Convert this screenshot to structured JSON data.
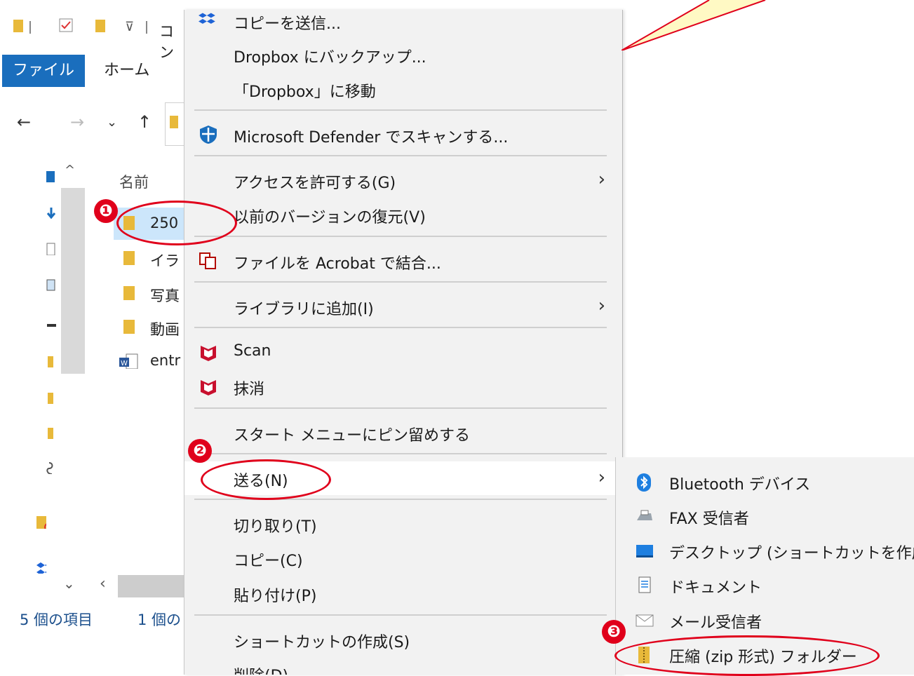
{
  "explorer": {
    "qat_title": "コン",
    "tab_file": "ファイル",
    "tab_home": "ホーム",
    "column_name": "名前",
    "files": [
      {
        "name": "250",
        "type": "folder",
        "selected": true
      },
      {
        "name": "イラ",
        "type": "folder"
      },
      {
        "name": "写真",
        "type": "folder"
      },
      {
        "name": "動画",
        "type": "folder"
      },
      {
        "name": "entr",
        "type": "word"
      }
    ],
    "status_count": "5 個の項目",
    "status_selected": "1 個の"
  },
  "context_menu": {
    "items": [
      {
        "label": "コピーを送信...",
        "icon": "dropbox-icon"
      },
      {
        "label": "Dropbox にバックアップ..."
      },
      {
        "label": "「Dropbox」に移動"
      },
      {
        "label": "Microsoft Defender でスキャンする...",
        "icon": "defender-shield-icon"
      },
      {
        "label": "アクセスを許可する(G)",
        "submenu": true
      },
      {
        "label": "以前のバージョンの復元(V)"
      },
      {
        "label": "ファイルを Acrobat で結合...",
        "icon": "acrobat-combine-icon"
      },
      {
        "label": "ライブラリに追加(I)",
        "submenu": true
      },
      {
        "label": "Scan",
        "icon": "mcafee-icon"
      },
      {
        "label": "抹消",
        "icon": "mcafee-icon"
      },
      {
        "label": "スタート メニューにピン留めする"
      },
      {
        "label": "送る(N)",
        "submenu": true,
        "highlighted": true
      },
      {
        "label": "切り取り(T)"
      },
      {
        "label": "コピー(C)"
      },
      {
        "label": "貼り付け(P)"
      },
      {
        "label": "ショートカットの作成(S)"
      },
      {
        "label": "削除(D)"
      }
    ]
  },
  "send_to_menu": {
    "items": [
      {
        "label": "Bluetooth デバイス",
        "icon": "bluetooth-icon"
      },
      {
        "label": "FAX 受信者",
        "icon": "fax-icon"
      },
      {
        "label": "デスクトップ (ショートカットを作成)",
        "icon": "desktop-icon"
      },
      {
        "label": "ドキュメント",
        "icon": "document-icon"
      },
      {
        "label": "メール受信者",
        "icon": "mail-icon"
      },
      {
        "label": "圧縮 (zip 形式) フォルダー",
        "icon": "zip-folder-icon"
      }
    ]
  },
  "annotations": {
    "step1": "❶",
    "step2": "❷",
    "step3": "❸"
  },
  "colors": {
    "accent_blue": "#1a6ebd",
    "annotation_red": "#e0001b",
    "callout_fill": "#fff9c4",
    "menu_bg": "#f2f2f2"
  }
}
